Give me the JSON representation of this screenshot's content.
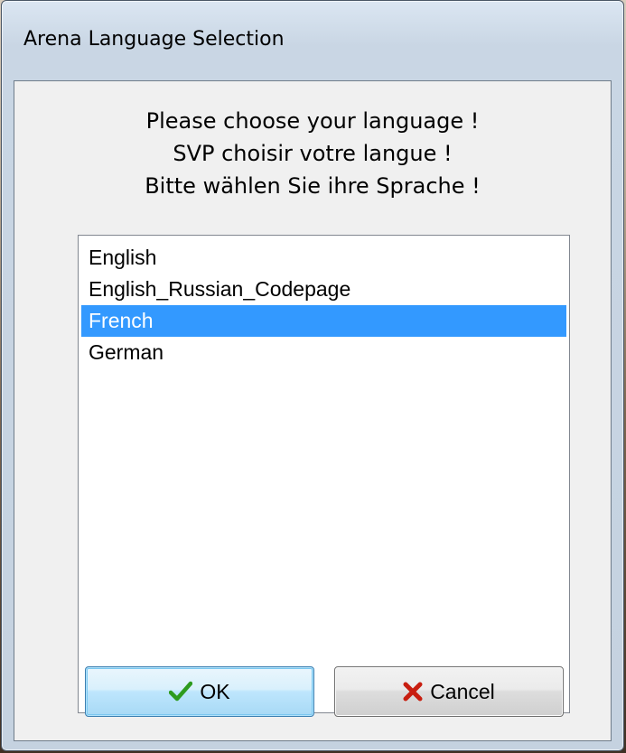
{
  "window": {
    "title": "Arena Language Selection"
  },
  "prompt": {
    "line1": "Please choose your language !",
    "line2": "SVP choisir votre langue !",
    "line3": "Bitte wählen Sie ihre Sprache !"
  },
  "languages": {
    "items": [
      {
        "label": "English"
      },
      {
        "label": "English_Russian_Codepage"
      },
      {
        "label": "French"
      },
      {
        "label": "German"
      }
    ],
    "selected": "French"
  },
  "buttons": {
    "ok_label": "OK",
    "ok_icon": "checkmark-icon",
    "cancel_label": "Cancel",
    "cancel_icon": "x-icon"
  },
  "colors": {
    "selection": "#3399ff",
    "ok_check": "#2e9b1e",
    "cancel_x": "#c81e10"
  }
}
